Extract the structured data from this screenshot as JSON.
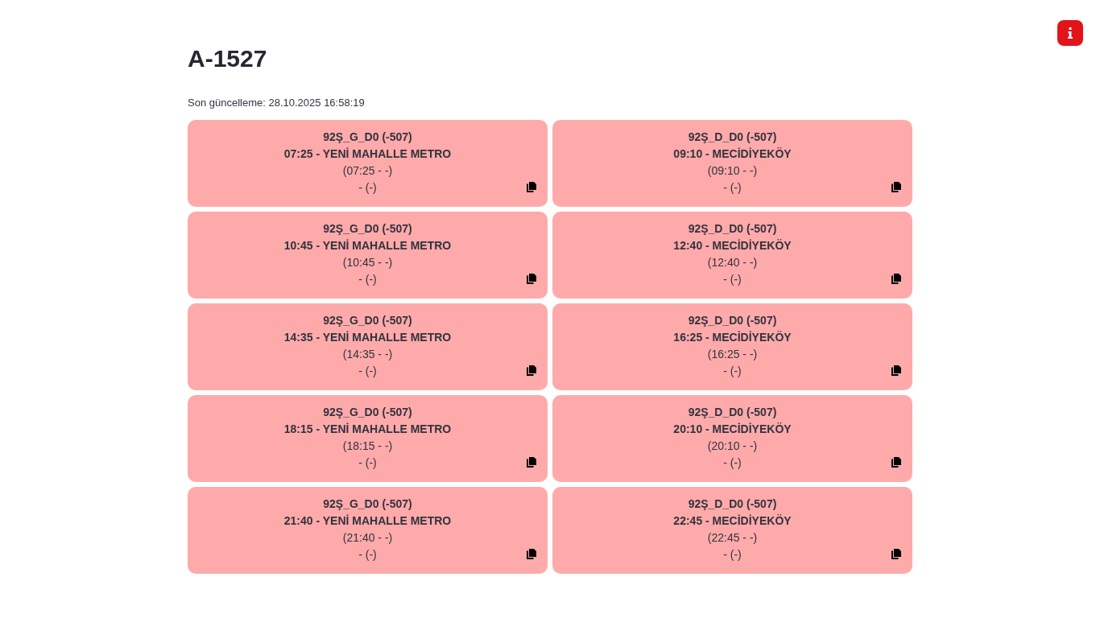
{
  "title": "A-1527",
  "last_updated": "Son güncelleme: 28.10.2025 16:58:19",
  "trips": [
    {
      "code": "92Ş_G_D0 (-507)",
      "departure": "07:25 - YENİ MAHALLE METRO",
      "line_3": "(07:25 - -)",
      "line_4": "- (-)"
    },
    {
      "code": "92Ş_D_D0 (-507)",
      "departure": "09:10 - MECİDİYEKÖY",
      "line_3": "(09:10 - -)",
      "line_4": "- (-)"
    },
    {
      "code": "92Ş_G_D0 (-507)",
      "departure": "10:45 - YENİ MAHALLE METRO",
      "line_3": "(10:45 - -)",
      "line_4": "- (-)"
    },
    {
      "code": "92Ş_D_D0 (-507)",
      "departure": "12:40 - MECİDİYEKÖY",
      "line_3": "(12:40 - -)",
      "line_4": "- (-)"
    },
    {
      "code": "92Ş_G_D0 (-507)",
      "departure": "14:35 - YENİ MAHALLE METRO",
      "line_3": "(14:35 - -)",
      "line_4": "- (-)"
    },
    {
      "code": "92Ş_D_D0 (-507)",
      "departure": "16:25 - MECİDİYEKÖY",
      "line_3": "(16:25 - -)",
      "line_4": "- (-)"
    },
    {
      "code": "92Ş_G_D0 (-507)",
      "departure": "18:15 - YENİ MAHALLE METRO",
      "line_3": "(18:15 - -)",
      "line_4": "- (-)"
    },
    {
      "code": "92Ş_D_D0 (-507)",
      "departure": "20:10 - MECİDİYEKÖY",
      "line_3": "(20:10 - -)",
      "line_4": "- (-)"
    },
    {
      "code": "92Ş_G_D0 (-507)",
      "departure": "21:40 - YENİ MAHALLE METRO",
      "line_3": "(21:40 - -)",
      "line_4": "- (-)"
    },
    {
      "code": "92Ş_D_D0 (-507)",
      "departure": "22:45 - MECİDİYEKÖY",
      "line_3": "(22:45 - -)",
      "line_4": "- (-)"
    }
  ]
}
